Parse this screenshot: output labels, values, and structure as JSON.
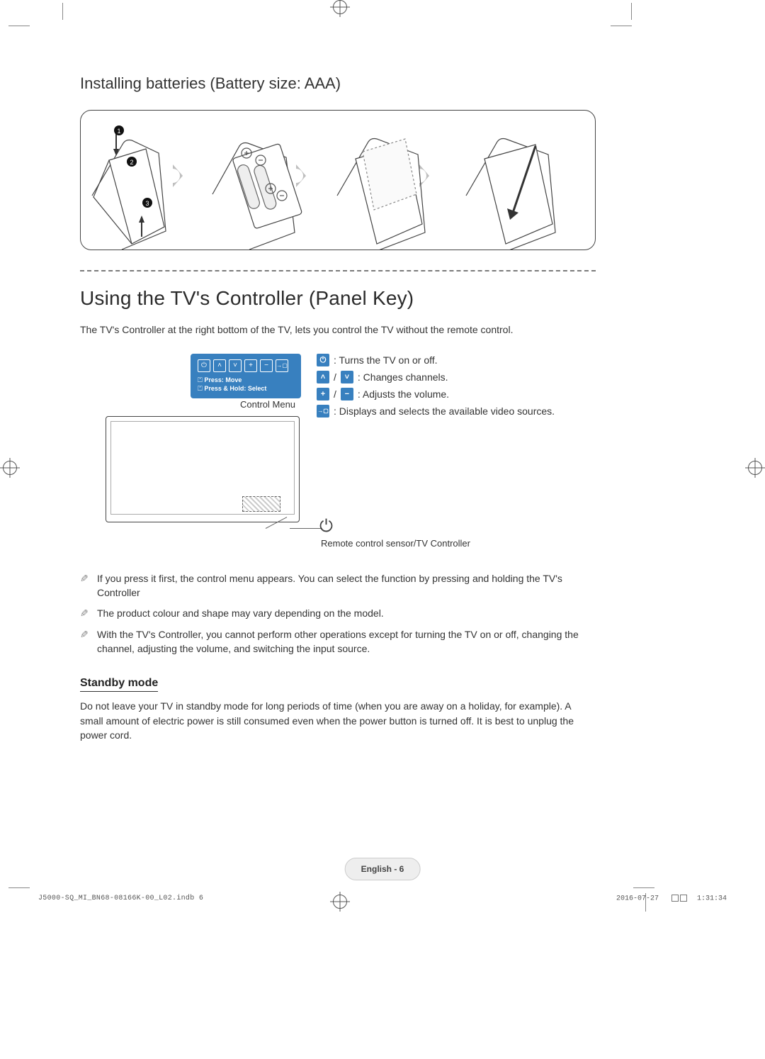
{
  "headings": {
    "install_batteries": "Installing batteries (Battery size: AAA)",
    "using_controller": "Using the TV's Controller (Panel Key)",
    "standby_mode": "Standby mode"
  },
  "paragraphs": {
    "controller_intro": "The TV's Controller at the right bottom of the TV, lets you control the TV without the remote control.",
    "standby_body": "Do not leave your TV in standby mode for long periods of time (when you are away on a holiday, for example). A small amount of electric power is still consumed even when the power button is turned off. It is best to unplug the power cord."
  },
  "control_menu": {
    "label": "Control Menu",
    "line1_prefix": "⏍",
    "line1": "Press: Move",
    "line2_prefix": "⏍",
    "line2": "Press & Hold: Select",
    "sensor_label": "Remote control sensor/TV Controller"
  },
  "legend": {
    "power": ": Turns the TV on or off.",
    "channels": ": Changes channels.",
    "volume": ": Adjusts the volume.",
    "source": ": Displays and selects the available video sources."
  },
  "notes": [
    "If you press it first, the control menu appears. You can select the function by pressing and holding the TV's Controller",
    "The product colour and shape may vary depending on the model.",
    "With the TV's Controller, you cannot perform other operations except for turning the TV on or off, changing the channel, adjusting the volume, and switching the input source."
  ],
  "footer": {
    "page_label": "English - 6",
    "left": "J5000-SQ_MI_BN68-08166K-00_L02.indb   6",
    "right_date": "2016-07-27",
    "right_time": "1:31:34"
  },
  "icons": {
    "power": "⏻",
    "up": "˄",
    "down": "˅",
    "plus": "+",
    "minus": "−",
    "source": "→▢"
  }
}
